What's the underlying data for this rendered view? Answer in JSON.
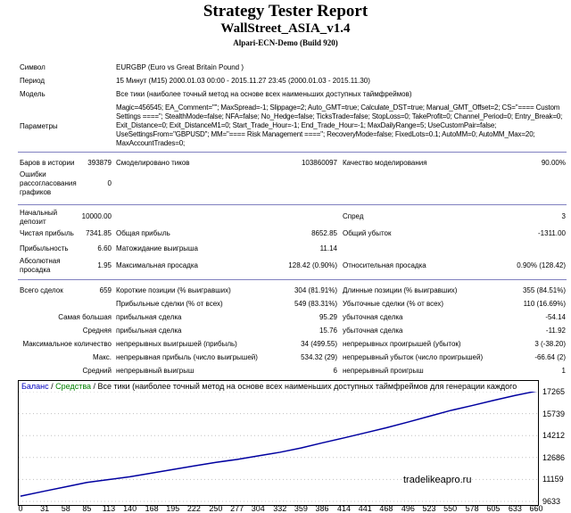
{
  "header": {
    "title": "Strategy Tester Report",
    "ea_name": "WallStreet_ASIA_v1.4",
    "server": "Alpari-ECN-Demo (Build 920)"
  },
  "info": {
    "symbol_label": "Символ",
    "symbol_value": "EURGBP (Euro vs Great Britain Pound )",
    "period_label": "Период",
    "period_value": "15 Минут (M15) 2000.01.03 00:00 - 2015.11.27 23:45 (2000.01.03 - 2015.11.30)",
    "model_label": "Модель",
    "model_value": "Все тики (наиболее точный метод на основе всех наименьших доступных таймфреймов)",
    "params_label": "Параметры",
    "params_value": "Magic=456545; EA_Comment=\"\"; MaxSpread=-1; Slippage=2; Auto_GMT=true; Calculate_DST=true; Manual_GMT_Offset=2; CS=\"==== Custom Settings ====\"; StealthMode=false; NFA=false; No_Hedge=false; TicksTrade=false; StopLoss=0; TakeProfit=0; Channel_Period=0; Entry_Break=0; Exit_Distance=0; Exit_DistanceM1=0; Start_Trade_Hour=-1; End_Trade_Hour=-1; MaxDailyRange=5; UseCustomPair=false; UseSettingsFrom=\"GBPUSD\"; MM=\"==== Risk Management ====\"; RecoveryMode=false; FixedLots=0.1; AutoMM=0; AutoMM_Max=20; MaxAccountTrades=0;"
  },
  "stats": {
    "bars_label": "Баров в истории",
    "bars_value": "393879",
    "ticks_label": "Смоделировано тиков",
    "ticks_value": "103860097",
    "quality_label": "Качество моделирования",
    "quality_value": "90.00%",
    "errors_label": "Ошибки рассогласования графиков",
    "errors_value": "0",
    "deposit_label": "Начальный депозит",
    "deposit_value": "10000.00",
    "spread_label": "Спред",
    "spread_value": "3",
    "net_label": "Чистая прибыль",
    "net_value": "7341.85",
    "gross_profit_label": "Общая прибыль",
    "gross_profit_value": "8652.85",
    "gross_loss_label": "Общий убыток",
    "gross_loss_value": "-1311.00",
    "pf_label": "Прибыльность",
    "pf_value": "6.60",
    "payoff_label": "Матожидание выигрыша",
    "payoff_value": "11.14",
    "abs_dd_label": "Абсолютная просадка",
    "abs_dd_value": "1.95",
    "max_dd_label": "Максимальная просадка",
    "max_dd_value": "128.42 (0.90%)",
    "rel_dd_label": "Относительная просадка",
    "rel_dd_value": "0.90% (128.42)",
    "trades_label": "Всего сделок",
    "trades_value": "659",
    "short_label": "Короткие позиции (% выигравших)",
    "short_value": "304 (81.91%)",
    "long_label": "Длинные позиции (% выигравших)",
    "long_value": "355 (84.51%)",
    "profit_trades_label": "Прибыльные сделки (% от всех)",
    "profit_trades_value": "549 (83.31%)",
    "loss_trades_label": "Убыточные сделки (% от всех)",
    "loss_trades_value": "110 (16.69%)",
    "largest_label": "Самая большая",
    "largest_profit_label": "прибыльная сделка",
    "largest_profit_value": "95.29",
    "largest_loss_label": "убыточная сделка",
    "largest_loss_value": "-54.14",
    "average_label": "Средняя",
    "avg_profit_label": "прибыльная сделка",
    "avg_profit_value": "15.76",
    "avg_loss_label": "убыточная сделка",
    "avg_loss_value": "-11.92",
    "maxcount_label": "Максимальное количество",
    "cons_wins_label": "непрерывных выигрышей (прибыль)",
    "cons_wins_value": "34 (499.55)",
    "cons_losses_label": "непрерывных проигрышей (убыток)",
    "cons_losses_value": "3 (-38.20)",
    "max_label": "Макс.",
    "cons_profit_label": "непрерывная прибыль (число выигрышей)",
    "cons_profit_value": "534.32 (29)",
    "cons_loss_label": "непрерывный убыток (число проигрышей)",
    "cons_loss_value": "-66.64 (2)",
    "avg2_label": "Средний",
    "avg_wins_label": "непрерывный выигрыш",
    "avg_wins_value": "6",
    "avg_losses_label": "непрерывный проигрыш",
    "avg_losses_value": "1"
  },
  "chart_legend": {
    "balance": "Баланс",
    "sep1": " / ",
    "funds": "Средства",
    "sep2": " / ",
    "model": "Все тики (наиболее точный метод на основе всех наименьших доступных таймфреймов для генерации каждого"
  },
  "watermark": "tradelikeapro.ru",
  "colors": {
    "balance_line": "#0000a0",
    "legend_balance": "#0000c0",
    "legend_funds": "#008000",
    "separator": "#8080c0",
    "grid": "#c0c0c0"
  },
  "chart_data": {
    "type": "line",
    "x_ticks": [
      "0",
      "31",
      "58",
      "85",
      "113",
      "140",
      "168",
      "195",
      "222",
      "250",
      "277",
      "304",
      "332",
      "359",
      "386",
      "414",
      "441",
      "468",
      "496",
      "523",
      "550",
      "578",
      "605",
      "633",
      "660"
    ],
    "y_ticks": [
      "17265",
      "15739",
      "14212",
      "12686",
      "11159",
      "9633"
    ],
    "ylim": [
      9633,
      17265
    ],
    "xlim": [
      0,
      660
    ],
    "series": [
      {
        "name": "Баланс",
        "x": [
          0,
          31,
          58,
          85,
          113,
          140,
          168,
          195,
          222,
          250,
          277,
          304,
          332,
          359,
          386,
          414,
          441,
          468,
          496,
          523,
          550,
          578,
          605,
          633,
          660
        ],
        "y": [
          10000,
          10350,
          10650,
          10950,
          11150,
          11350,
          11600,
          11850,
          12100,
          12350,
          12550,
          12800,
          13050,
          13350,
          13700,
          14050,
          14400,
          14750,
          15150,
          15550,
          15950,
          16300,
          16650,
          17000,
          17300
        ]
      }
    ]
  }
}
